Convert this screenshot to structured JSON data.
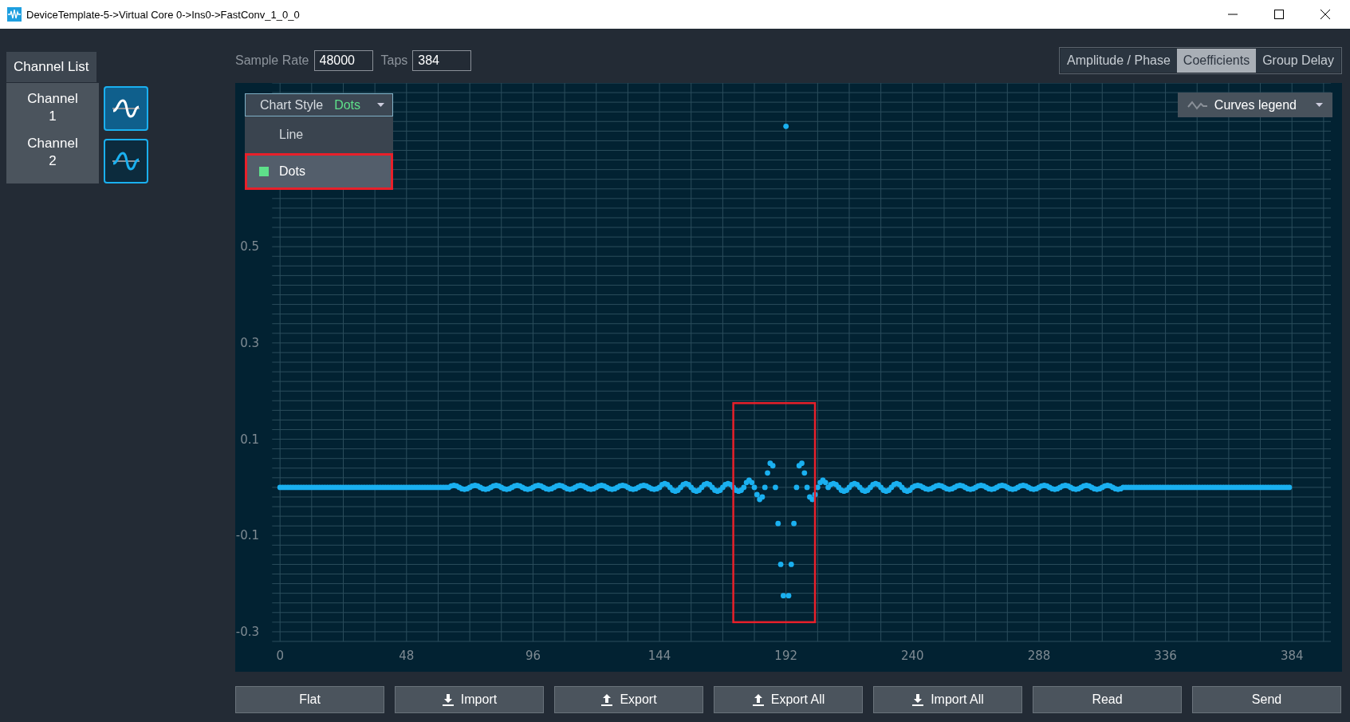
{
  "window": {
    "title": "DeviceTemplate-5->Virtual Core 0->Ins0->FastConv_1_0_0"
  },
  "channel_list": {
    "title": "Channel List",
    "channels": [
      {
        "label": "Channel 1",
        "selected": true
      },
      {
        "label": "Channel 2",
        "selected": false
      }
    ]
  },
  "params": {
    "sample_rate": {
      "label": "Sample Rate",
      "value": "48000"
    },
    "taps": {
      "label": "Taps",
      "value": "384"
    }
  },
  "view_tabs": [
    {
      "label": "Amplitude / Phase",
      "selected": false
    },
    {
      "label": "Coefficients",
      "selected": true
    },
    {
      "label": "Group Delay",
      "selected": false
    }
  ],
  "chart_style": {
    "label": "Chart Style",
    "value": "Dots",
    "expanded": true,
    "options": [
      {
        "label": "Line",
        "selected": false
      },
      {
        "label": "Dots",
        "selected": true
      }
    ]
  },
  "legend": {
    "label": "Curves legend"
  },
  "chart_data": {
    "type": "scatter",
    "grid": true,
    "x": [
      0,
      1,
      2,
      3,
      4,
      5,
      6,
      7,
      8,
      9,
      10,
      11,
      12,
      13,
      14,
      15,
      16,
      17,
      18,
      19,
      20,
      21,
      22,
      23,
      24,
      25,
      26,
      27,
      28,
      29,
      30,
      31,
      32,
      33,
      34,
      35,
      36,
      37,
      38,
      39,
      40,
      41,
      42,
      43,
      44,
      45,
      46,
      47,
      48,
      49,
      50,
      51,
      52,
      53,
      54,
      55,
      56,
      57,
      58,
      59,
      60,
      61,
      62,
      63,
      64,
      65,
      66,
      67,
      68,
      69,
      70,
      71,
      72,
      73,
      74,
      75,
      76,
      77,
      78,
      79,
      80,
      81,
      82,
      83,
      84,
      85,
      86,
      87,
      88,
      89,
      90,
      91,
      92,
      93,
      94,
      95,
      96,
      97,
      98,
      99,
      100,
      101,
      102,
      103,
      104,
      105,
      106,
      107,
      108,
      109,
      110,
      111,
      112,
      113,
      114,
      115,
      116,
      117,
      118,
      119,
      120,
      121,
      122,
      123,
      124,
      125,
      126,
      127,
      128,
      129,
      130,
      131,
      132,
      133,
      134,
      135,
      136,
      137,
      138,
      139,
      140,
      141,
      142,
      143,
      144,
      145,
      146,
      147,
      148,
      149,
      150,
      151,
      152,
      153,
      154,
      155,
      156,
      157,
      158,
      159,
      160,
      161,
      162,
      163,
      164,
      165,
      166,
      167,
      168,
      169,
      170,
      171,
      172,
      173,
      174,
      175,
      176,
      177,
      178,
      179,
      180,
      181,
      182,
      183,
      184,
      185,
      186,
      187,
      188,
      189,
      190,
      191,
      192,
      193,
      194,
      195,
      196,
      197,
      198,
      199,
      200,
      201,
      202,
      203,
      204,
      205,
      206,
      207,
      208,
      209,
      210,
      211,
      212,
      213,
      214,
      215,
      216,
      217,
      218,
      219,
      220,
      221,
      222,
      223,
      224,
      225,
      226,
      227,
      228,
      229,
      230,
      231,
      232,
      233,
      234,
      235,
      236,
      237,
      238,
      239,
      240,
      241,
      242,
      243,
      244,
      245,
      246,
      247,
      248,
      249,
      250,
      251,
      252,
      253,
      254,
      255,
      256,
      257,
      258,
      259,
      260,
      261,
      262,
      263,
      264,
      265,
      266,
      267,
      268,
      269,
      270,
      271,
      272,
      273,
      274,
      275,
      276,
      277,
      278,
      279,
      280,
      281,
      282,
      283,
      284,
      285,
      286,
      287,
      288,
      289,
      290,
      291,
      292,
      293,
      294,
      295,
      296,
      297,
      298,
      299,
      300,
      301,
      302,
      303,
      304,
      305,
      306,
      307,
      308,
      309,
      310,
      311,
      312,
      313,
      314,
      315,
      316,
      317,
      318,
      319,
      320,
      321,
      322,
      323,
      324,
      325,
      326,
      327,
      328,
      329,
      330,
      331,
      332,
      333,
      334,
      335,
      336,
      337,
      338,
      339,
      340,
      341,
      342,
      343,
      344,
      345,
      346,
      347,
      348,
      349,
      350,
      351,
      352,
      353,
      354,
      355,
      356,
      357,
      358,
      359,
      360,
      361,
      362,
      363,
      364,
      365,
      366,
      367,
      368,
      369,
      370,
      371,
      372,
      373,
      374,
      375,
      376,
      377,
      378,
      379,
      380,
      381,
      382,
      383
    ],
    "xlim": [
      -17,
      403
    ],
    "ylim": [
      -0.32,
      0.84
    ],
    "xticks": [
      0,
      48,
      96,
      144,
      192,
      240,
      288,
      336,
      384
    ],
    "yticks": [
      -0.3,
      -0.1,
      0.1,
      0.3,
      0.5
    ],
    "series": [
      {
        "color": "#1ab0f0",
        "values": [
          0,
          0,
          0,
          0,
          0,
          0,
          0,
          0,
          0,
          0,
          0,
          0,
          0,
          0,
          0,
          0,
          0,
          0,
          0,
          0,
          0,
          0,
          0,
          0,
          0,
          0,
          0,
          0,
          0,
          0,
          0,
          0,
          0,
          0,
          0,
          0,
          0,
          0,
          0,
          0,
          0,
          0,
          0,
          0,
          0,
          0,
          0,
          0,
          0,
          0,
          0,
          0,
          0,
          0,
          0,
          0,
          0,
          0,
          0,
          0,
          0,
          0,
          0,
          0,
          0,
          0.003,
          0.004,
          0.003,
          0,
          -0.003,
          -0.004,
          -0.003,
          0,
          0.003,
          0.004,
          0.003,
          0,
          -0.003,
          -0.004,
          -0.003,
          0,
          0.003,
          0.004,
          0.003,
          0,
          -0.003,
          -0.004,
          -0.003,
          0,
          0.003,
          0.004,
          0.003,
          0,
          -0.003,
          -0.004,
          -0.003,
          0,
          0.003,
          0.004,
          0.003,
          0,
          -0.003,
          -0.004,
          -0.003,
          0,
          0.003,
          0.004,
          0.003,
          0,
          -0.003,
          -0.004,
          -0.003,
          0,
          0.003,
          0.004,
          0.003,
          0,
          -0.003,
          -0.004,
          -0.003,
          0,
          0.003,
          0.004,
          0.003,
          0,
          -0.003,
          -0.004,
          -0.003,
          0,
          0.003,
          0.004,
          0.003,
          0,
          -0.003,
          -0.004,
          -0.003,
          0,
          0.003,
          0.004,
          0.003,
          0,
          -0.003,
          -0.004,
          -0.003,
          0,
          0.006,
          0.008,
          0.006,
          0,
          -0.006,
          -0.008,
          -0.006,
          0,
          0.006,
          0.008,
          0.006,
          0,
          -0.006,
          -0.008,
          -0.006,
          0,
          0.006,
          0.008,
          0.006,
          0,
          -0.006,
          -0.008,
          -0.006,
          0,
          0.006,
          0.008,
          0.006,
          0,
          -0.006,
          -0.008,
          -0.006,
          0,
          0.01,
          0.015,
          0.01,
          0,
          -0.015,
          -0.025,
          -0.02,
          0,
          0.03,
          0.05,
          0.045,
          0,
          -0.075,
          -0.16,
          -0.225,
          0.75,
          -0.225,
          -0.16,
          -0.075,
          0,
          0.045,
          0.05,
          0.03,
          0,
          -0.02,
          -0.025,
          -0.015,
          0,
          0.01,
          0.015,
          0.01,
          0,
          0.006,
          0.008,
          0.006,
          0,
          -0.006,
          -0.008,
          -0.006,
          0,
          0.006,
          0.008,
          0.006,
          0,
          -0.006,
          -0.008,
          -0.006,
          0,
          0.006,
          0.008,
          0.006,
          0,
          -0.006,
          -0.008,
          -0.006,
          0,
          0.006,
          0.008,
          0.006,
          0,
          -0.006,
          -0.008,
          -0.006,
          0,
          0.003,
          0.004,
          0.003,
          0,
          -0.003,
          -0.004,
          -0.003,
          0,
          0.003,
          0.004,
          0.003,
          0,
          -0.003,
          -0.004,
          -0.003,
          0,
          0.003,
          0.004,
          0.003,
          0,
          -0.003,
          -0.004,
          -0.003,
          0,
          0.003,
          0.004,
          0.003,
          0,
          -0.003,
          -0.004,
          -0.003,
          0,
          0.003,
          0.004,
          0.003,
          0,
          -0.003,
          -0.004,
          -0.003,
          0,
          0.003,
          0.004,
          0.003,
          0,
          -0.003,
          -0.004,
          -0.003,
          0,
          0.003,
          0.004,
          0.003,
          0,
          -0.003,
          -0.004,
          -0.003,
          0,
          0.003,
          0.004,
          0.003,
          0,
          -0.003,
          -0.004,
          -0.003,
          0,
          0.003,
          0.004,
          0.003,
          0,
          -0.003,
          -0.004,
          -0.003,
          0,
          0.003,
          0.004,
          0.003,
          0,
          -0.003,
          -0.004,
          -0.003,
          0,
          0,
          0,
          0,
          0,
          0,
          0,
          0,
          0,
          0,
          0,
          0,
          0,
          0,
          0,
          0,
          0,
          0,
          0,
          0,
          0,
          0,
          0,
          0,
          0,
          0,
          0,
          0,
          0,
          0,
          0,
          0,
          0,
          0,
          0,
          0,
          0,
          0,
          0,
          0,
          0,
          0,
          0,
          0,
          0,
          0,
          0,
          0,
          0,
          0,
          0,
          0,
          0,
          0,
          0,
          0,
          0,
          0,
          0,
          0,
          0,
          0,
          0,
          0
        ]
      }
    ]
  },
  "buttons": [
    {
      "label": "Flat",
      "kind": "plain"
    },
    {
      "label": "Import",
      "kind": "download"
    },
    {
      "label": "Export",
      "kind": "upload"
    },
    {
      "label": "Export All",
      "kind": "upload"
    },
    {
      "label": "Import All",
      "kind": "download"
    },
    {
      "label": "Read",
      "kind": "plain"
    },
    {
      "label": "Send",
      "kind": "plain"
    }
  ]
}
